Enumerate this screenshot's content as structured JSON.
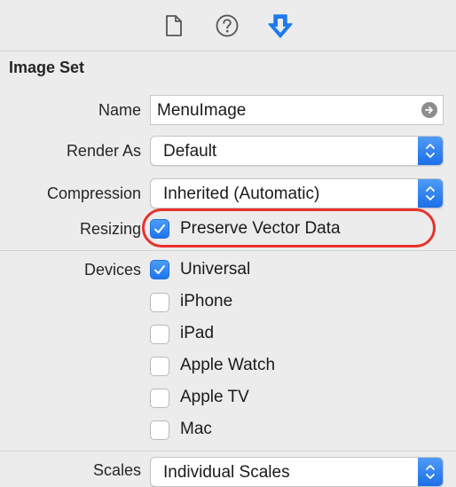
{
  "toolbar": {
    "icons": [
      "file-inspector-icon",
      "quick-help-icon",
      "attributes-inspector-icon"
    ],
    "accent": "#1f7aee"
  },
  "section": {
    "title": "Image Set"
  },
  "form": {
    "name_label": "Name",
    "name_value": "MenuImage",
    "render_as_label": "Render As",
    "render_as_value": "Default",
    "compression_label": "Compression",
    "compression_value": "Inherited (Automatic)",
    "resizing_label": "Resizing",
    "resizing_option": "Preserve Vector Data",
    "resizing_checked": true,
    "devices_label": "Devices",
    "devices": [
      {
        "label": "Universal",
        "checked": true
      },
      {
        "label": "iPhone",
        "checked": false
      },
      {
        "label": "iPad",
        "checked": false
      },
      {
        "label": "Apple Watch",
        "checked": false
      },
      {
        "label": "Apple TV",
        "checked": false
      },
      {
        "label": "Mac",
        "checked": false
      }
    ],
    "scales_label": "Scales",
    "scales_value": "Individual Scales"
  },
  "colors": {
    "highlight": "#e8322c",
    "checkbox_on": "#1f74ee"
  }
}
